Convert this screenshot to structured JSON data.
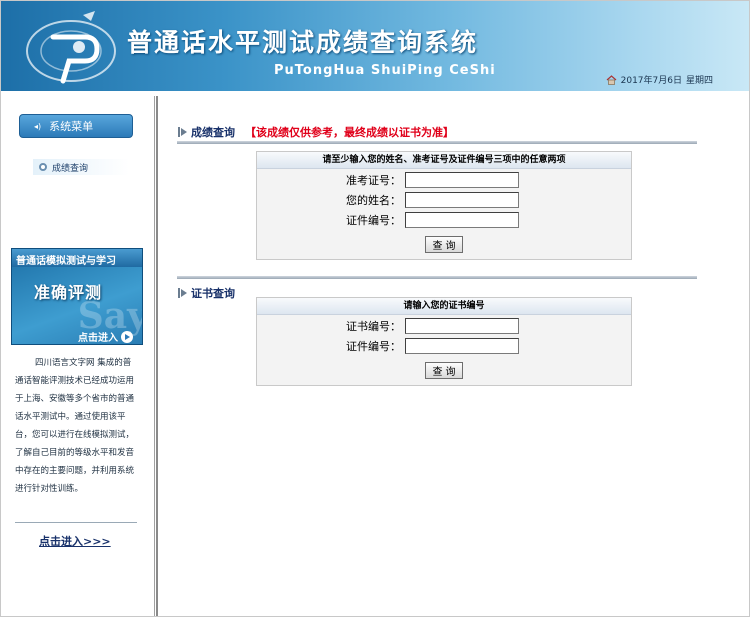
{
  "header": {
    "title": "普通话水平测试成绩查询系统",
    "subtitle": "PuTongHua ShuiPing CeShi",
    "date": "2017年7月6日",
    "weekday": "星期四"
  },
  "sidebar": {
    "menu_button": "系统菜单",
    "items": [
      {
        "label": "成绩查询"
      }
    ],
    "promo": {
      "top_text": "普通话模拟测试与学习",
      "main_text": "准确评测",
      "link_text": "点击进入",
      "bg_text": "Say"
    },
    "description": "四川语言文字网 集成的普通话智能评测技术已经成功运用于上海、安徽等多个省市的普通话水平测试中。通过使用该平台，您可以进行在线模拟测试，了解自己目前的等级水平和发音中存在的主要问题，并利用系统进行针对性训练。",
    "enter_link": "点击进入>>>"
  },
  "score_query": {
    "heading": "成绩查询",
    "notice": "【该成绩仅供参考，最终成绩以证书为准】",
    "caption": "请至少输入您的姓名、准考证号及证件编号三项中的任意两项",
    "fields": [
      {
        "label": "准考证号：",
        "value": ""
      },
      {
        "label": "您的姓名：",
        "value": ""
      },
      {
        "label": "证件编号：",
        "value": ""
      }
    ],
    "button": "查询"
  },
  "cert_query": {
    "heading": "证书查询",
    "caption": "请输入您的证书编号",
    "fields": [
      {
        "label": "证书编号：",
        "value": ""
      },
      {
        "label": "证件编号：",
        "value": ""
      }
    ],
    "button": "查询"
  }
}
